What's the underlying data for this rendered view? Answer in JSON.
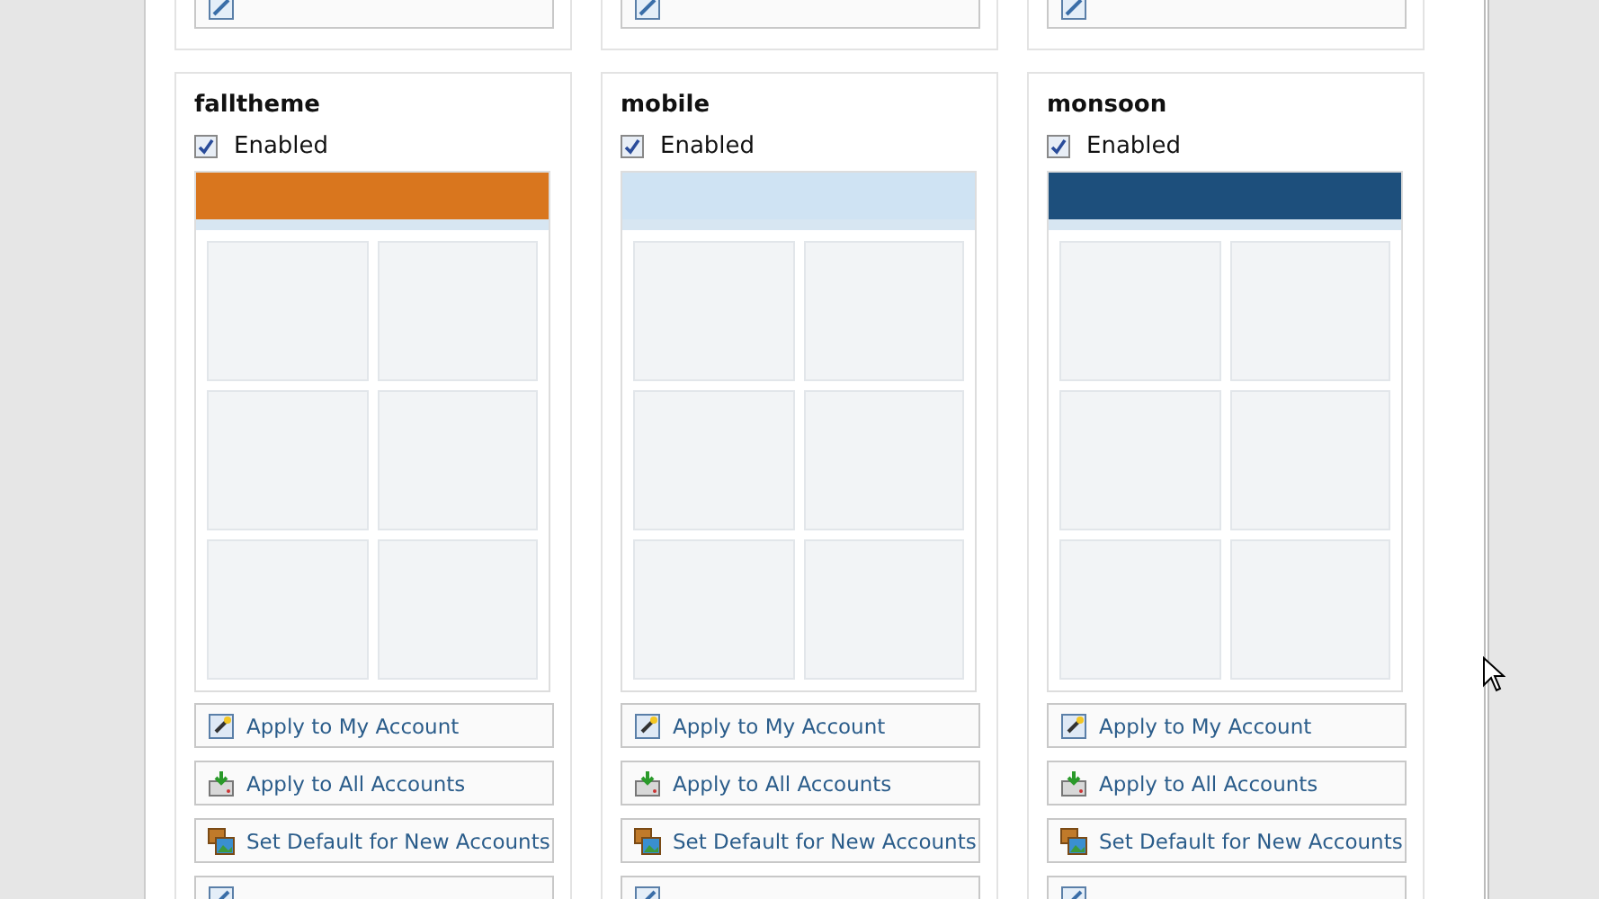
{
  "top_row": [
    {
      "kind": "edit"
    },
    {
      "kind": "edit"
    },
    {
      "kind": "edit"
    }
  ],
  "themes": [
    {
      "name": "falltheme",
      "enabled": true,
      "enabled_label": "Enabled",
      "color": "#d9761e",
      "buttons": [
        {
          "kind": "apply-mine",
          "label": "Apply to My Account"
        },
        {
          "kind": "apply-all",
          "label": "Apply to All Accounts"
        },
        {
          "kind": "default",
          "label": "Set Default for New Accounts"
        },
        {
          "kind": "edit"
        }
      ]
    },
    {
      "name": "mobile",
      "enabled": true,
      "enabled_label": "Enabled",
      "color": "#cfe3f3",
      "buttons": [
        {
          "kind": "apply-mine",
          "label": "Apply to My Account"
        },
        {
          "kind": "apply-all",
          "label": "Apply to All Accounts"
        },
        {
          "kind": "default",
          "label": "Set Default for New Accounts"
        },
        {
          "kind": "edit"
        }
      ]
    },
    {
      "name": "monsoon",
      "enabled": true,
      "enabled_label": "Enabled",
      "color": "#1d4f7c",
      "buttons": [
        {
          "kind": "apply-mine",
          "label": "Apply to My Account"
        },
        {
          "kind": "apply-all",
          "label": "Apply to All Accounts"
        },
        {
          "kind": "default",
          "label": "Set Default for New Accounts"
        },
        {
          "kind": "edit"
        }
      ]
    }
  ]
}
